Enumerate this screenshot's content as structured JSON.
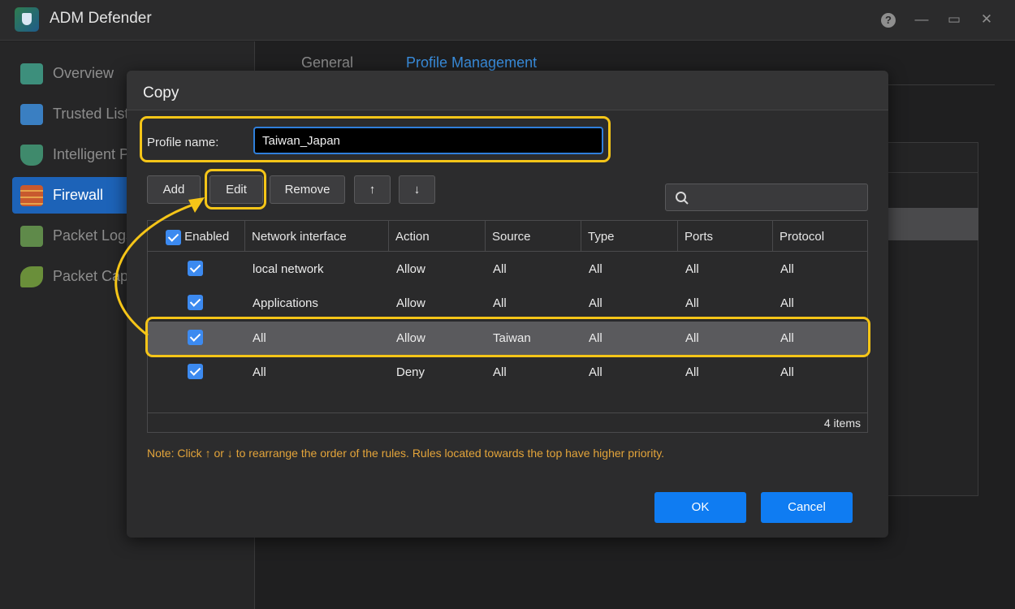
{
  "app": {
    "title": "ADM Defender"
  },
  "window_controls": {
    "help": "?",
    "minimize": "—",
    "maximize": "▭",
    "close": "✕"
  },
  "sidebar": {
    "items": [
      {
        "label": "Overview",
        "icon": "overview-icon",
        "color": "#3d8f7c"
      },
      {
        "label": "Trusted List",
        "icon": "trusted-list-icon",
        "color": "#3a7fc2"
      },
      {
        "label": "Intelligent P",
        "icon": "shield-icon",
        "color": "#3f8a6c"
      },
      {
        "label": "Firewall",
        "icon": "firewall-icon",
        "color": "#c8592e",
        "active": true
      },
      {
        "label": "Packet Logs",
        "icon": "packet-logs-icon",
        "color": "#5f8a4a"
      },
      {
        "label": "Packet Capt",
        "icon": "packet-capture-icon",
        "color": "#6a8f3a"
      }
    ]
  },
  "main": {
    "tabs": [
      {
        "label": "General"
      },
      {
        "label": "Profile Management"
      }
    ]
  },
  "dialog": {
    "title": "Copy",
    "profile_label": "Profile name:",
    "profile_value": "Taiwan_Japan",
    "buttons": {
      "add": "Add",
      "edit": "Edit",
      "remove": "Remove",
      "up": "↑",
      "down": "↓"
    },
    "search": {
      "placeholder": "",
      "icon": "search-icon"
    },
    "table": {
      "columns": [
        "Enabled",
        "Network interface",
        "Action",
        "Source",
        "Type",
        "Ports",
        "Protocol"
      ],
      "rows": [
        {
          "enabled": true,
          "network_interface": "local network",
          "action": "Allow",
          "source": "All",
          "type": "All",
          "ports": "All",
          "protocol": "All"
        },
        {
          "enabled": true,
          "network_interface": "Applications",
          "action": "Allow",
          "source": "All",
          "type": "All",
          "ports": "All",
          "protocol": "All"
        },
        {
          "enabled": true,
          "network_interface": "All",
          "action": "Allow",
          "source": "Taiwan",
          "type": "All",
          "ports": "All",
          "protocol": "All",
          "selected": true
        },
        {
          "enabled": true,
          "network_interface": "All",
          "action": "Deny",
          "source": "All",
          "type": "All",
          "ports": "All",
          "protocol": "All"
        }
      ],
      "count": "4 items"
    },
    "note": "Note: Click ↑ or ↓ to rearrange the order of the rules. Rules located towards the top have higher priority.",
    "ok": "OK",
    "cancel": "Cancel"
  },
  "colors": {
    "accent": "#0f7cf2",
    "highlight": "#f5c518",
    "note": "#e3a43a"
  }
}
